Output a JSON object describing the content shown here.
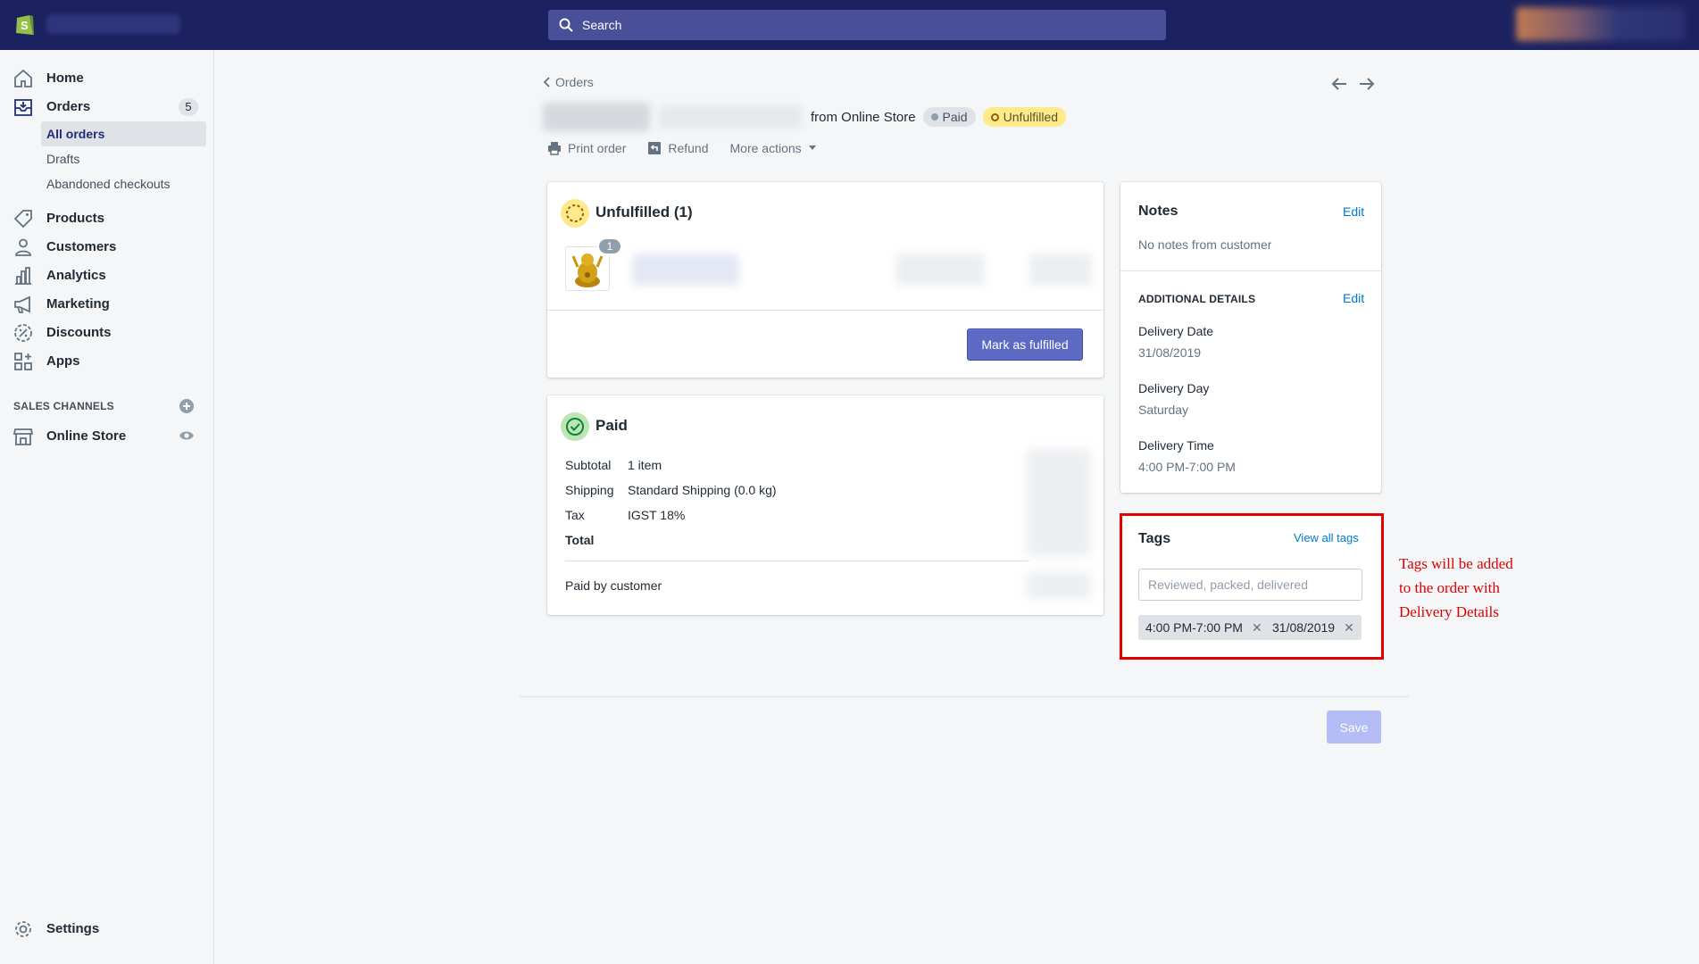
{
  "search": {
    "placeholder": "Search"
  },
  "sidebar": {
    "items": [
      {
        "label": "Home",
        "icon": "home-icon"
      },
      {
        "label": "Orders",
        "icon": "orders-icon",
        "count": "5"
      },
      {
        "label": "Products",
        "icon": "tag-icon"
      },
      {
        "label": "Customers",
        "icon": "person-icon"
      },
      {
        "label": "Analytics",
        "icon": "bar-chart-icon"
      },
      {
        "label": "Marketing",
        "icon": "megaphone-icon"
      },
      {
        "label": "Discounts",
        "icon": "discount-icon"
      },
      {
        "label": "Apps",
        "icon": "apps-icon"
      }
    ],
    "orders_sub": [
      "All orders",
      "Drafts",
      "Abandoned checkouts"
    ],
    "sales_channels_title": "SALES CHANNELS",
    "online_store": "Online Store",
    "settings": "Settings"
  },
  "order": {
    "breadcrumb": "Orders",
    "from_text": "from Online Store",
    "paid_badge": "Paid",
    "unfulfilled_badge": "Unfulfilled",
    "actions": {
      "print": "Print order",
      "refund": "Refund",
      "more": "More actions"
    }
  },
  "unfulfilled_card": {
    "title": "Unfulfilled (1)",
    "item_quantity": "1",
    "button": "Mark as fulfilled"
  },
  "paid_card": {
    "title": "Paid",
    "rows": [
      {
        "label": "Subtotal",
        "value": "1 item"
      },
      {
        "label": "Shipping",
        "value": "Standard Shipping (0.0 kg)"
      },
      {
        "label": "Tax",
        "value": "IGST 18%"
      },
      {
        "label": "Total",
        "value": ""
      }
    ],
    "paid_by": "Paid by customer"
  },
  "notes": {
    "title": "Notes",
    "edit": "Edit",
    "body": "No notes from customer"
  },
  "additional": {
    "title": "ADDITIONAL DETAILS",
    "edit": "Edit",
    "fields": [
      {
        "label": "Delivery Date",
        "value": "31/08/2019"
      },
      {
        "label": "Delivery Day",
        "value": "Saturday"
      },
      {
        "label": "Delivery Time",
        "value": "4:00 PM-7:00 PM"
      }
    ]
  },
  "tags": {
    "title": "Tags",
    "view_all": "View all tags",
    "placeholder": "Reviewed, packed, delivered",
    "items": [
      "4:00 PM-7:00 PM",
      "31/08/2019"
    ]
  },
  "annotation": [
    "Tags will be added",
    "to the order with",
    "Delivery Details"
  ],
  "save": "Save",
  "colors": {
    "topbar": "#1c2260",
    "primary": "#5c6ac4",
    "annotation": "#e00000",
    "unfulfilled": "#ffea8a",
    "paid_green": "#50b83c"
  }
}
